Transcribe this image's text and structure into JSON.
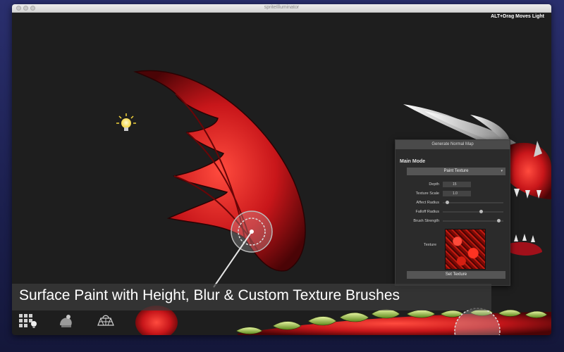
{
  "window": {
    "title": "spriteIlluminator"
  },
  "viewport": {
    "hint": "ALT+Drag Moves Light"
  },
  "panel": {
    "title": "Generate Normal Map",
    "main_mode_label": "Main Mode",
    "mode_value": "Paint Texture",
    "params": [
      {
        "label": "Depth",
        "value": "15"
      },
      {
        "label": "Texture Scale",
        "value": "1.0"
      },
      {
        "label": "Affect Radius",
        "level": 0.05
      },
      {
        "label": "Falloff Radius",
        "level": 0.6
      },
      {
        "label": "Brush Strength",
        "level": 0.9
      }
    ],
    "texture_label": "Texture",
    "set_texture_label": "Set Texture"
  },
  "caption": "Surface Paint with Height, Blur & Custom Texture Brushes",
  "colors": {
    "accent": "#c8161a",
    "panel_bg": "#2b2b2b",
    "scene_bg": "#1e1e1e"
  }
}
